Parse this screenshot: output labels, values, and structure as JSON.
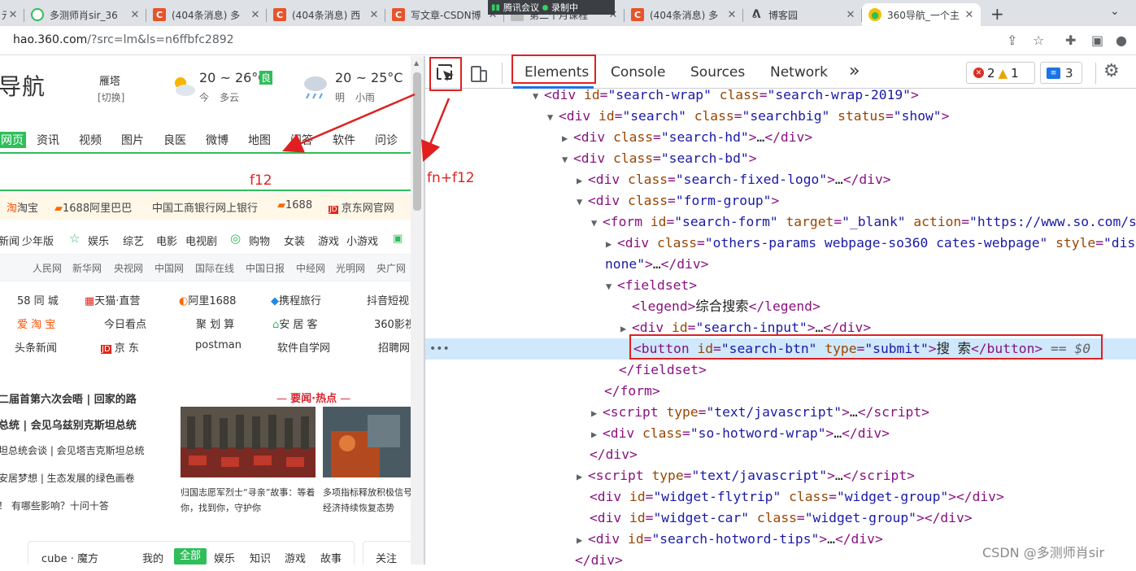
{
  "tabs": [
    {
      "label": "元",
      "icon": "generic",
      "color": "#888888"
    },
    {
      "label": "多测师肖sir_36",
      "icon": "360-icon",
      "color": "#2fbe5a"
    },
    {
      "label": "(404条消息) 多",
      "icon": "csdn-icon",
      "color": "#e6542c"
    },
    {
      "label": "(404条消息) 西",
      "icon": "csdn-icon",
      "color": "#e6542c"
    },
    {
      "label": "写文章-CSDN博",
      "icon": "csdn-icon",
      "color": "#e6542c"
    },
    {
      "label": "第二个月课程",
      "icon": "generic",
      "color": "#888888"
    },
    {
      "label": "(404条消息) 多",
      "icon": "csdn-icon",
      "color": "#e6542c"
    },
    {
      "label": "博客园",
      "icon": "cnblogs-icon",
      "color": "#555555"
    },
    {
      "label": "360导航_一个主",
      "icon": "360-icon",
      "color": "#f3c000"
    }
  ],
  "overlay": {
    "meeting": "腾讯会议",
    "recording": "录制中"
  },
  "address": {
    "host": "hao.360.com",
    "path": "/?src=lm&ls=n6ffbfc2892"
  },
  "page": {
    "logo": "导航",
    "weather": {
      "city": "雁塔",
      "switch": "[切换]",
      "today_temp": "20 ~ 26°C",
      "aqi": "良",
      "today_label": "今",
      "today_desc": "多云",
      "tomorrow_temp": "20 ~ 25°C",
      "tomorrow_label": "明",
      "tomorrow_desc": "小雨"
    },
    "nav": [
      "网页",
      "资讯",
      "视频",
      "图片",
      "良医",
      "微博",
      "地图",
      "问答",
      "软件",
      "问诊"
    ],
    "hot": [
      "淘宝",
      "1688阿里巴巴",
      "中国工商银行网上银行",
      "1688",
      "京东网官网"
    ],
    "categories": [
      "新闻",
      "少年版",
      "娱乐",
      "综艺",
      "电影",
      "电视剧",
      "购物",
      "女装",
      "游戏",
      "小游戏"
    ],
    "media": [
      "人民网",
      "新华网",
      "央视网",
      "中国网",
      "国际在线",
      "中国日报",
      "中经网",
      "光明网",
      "央广网"
    ],
    "sites": [
      [
        "58 同 城",
        "天猫·直营",
        "阿里1688",
        "携程旅行",
        "抖音短视"
      ],
      [
        "爱 淘 宝",
        "今日看点",
        "聚 划 算",
        "安 居 客",
        "360影视"
      ],
      [
        "头条新闻",
        "京 东",
        "postman",
        "软件自学网",
        "招聘网"
      ]
    ],
    "news_header": "要闻·热点",
    "news": [
      "二届首第六次会晤 | 回家的路",
      "总统 | 会见乌兹别克斯坦总统",
      "坦总统会谈 | 会见塔吉克斯坦总统",
      "安居梦想 | 生态发展的绿色画卷",
      "！ 有哪些影响？十问十答"
    ],
    "photo_captions": [
      "归国志愿军烈士“寻亲”故事：等着你，找到你，守护你",
      "多项指标释放积极信号 经济持续恢复态势"
    ],
    "cube": {
      "label": "cube · 魔方",
      "mine": "我的",
      "all": "全部",
      "tabs": [
        "娱乐",
        "知识",
        "游戏",
        "故事"
      ],
      "follow": "关注"
    }
  },
  "devtools": {
    "tabs": [
      "Elements",
      "Console",
      "Sources",
      "Network"
    ],
    "more": "»",
    "errors": "2",
    "warnings": "1",
    "messages": "3"
  },
  "annotations": {
    "f12": "f12",
    "fnf12": "fn+f12"
  },
  "watermark": "CSDN @多测师肖sir"
}
